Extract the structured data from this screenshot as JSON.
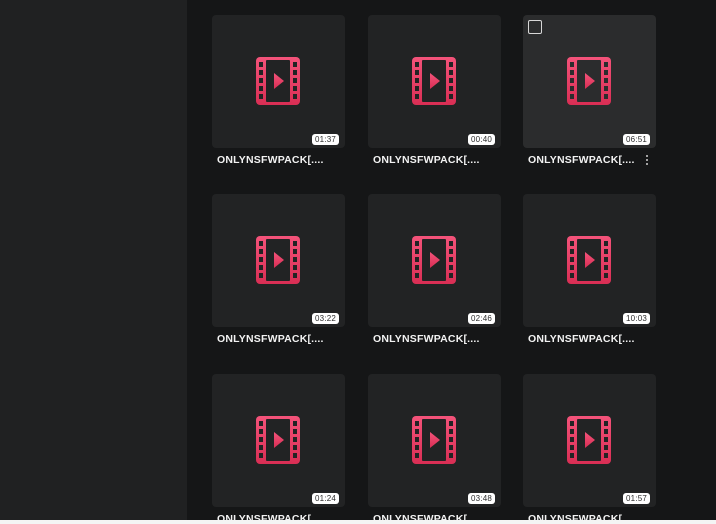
{
  "videos": [
    {
      "duration": "01:37",
      "title": "ONLYNSFWPACK[...."
    },
    {
      "duration": "00:40",
      "title": "ONLYNSFWPACK[...."
    },
    {
      "duration": "06:51",
      "title": "ONLYNSFWPACK[...."
    },
    {
      "duration": "03:22",
      "title": "ONLYNSFWPACK[...."
    },
    {
      "duration": "02:46",
      "title": "ONLYNSFWPACK[...."
    },
    {
      "duration": "10:03",
      "title": "ONLYNSFWPACK[...."
    },
    {
      "duration": "01:24",
      "title": "ONLYNSFWPACK["
    },
    {
      "duration": "03:48",
      "title": "ONLYNSFWPACK["
    },
    {
      "duration": "01:57",
      "title": "ONLYNSFWPACK["
    }
  ],
  "colors": {
    "icon_top": "#f4537a",
    "icon_bottom": "#d92e54",
    "icon_cutout": "#222324"
  },
  "icons": {
    "video_thumbnail": "video-file-icon",
    "selection": "checkbox-icon",
    "more_options": "kebab-menu-icon"
  }
}
